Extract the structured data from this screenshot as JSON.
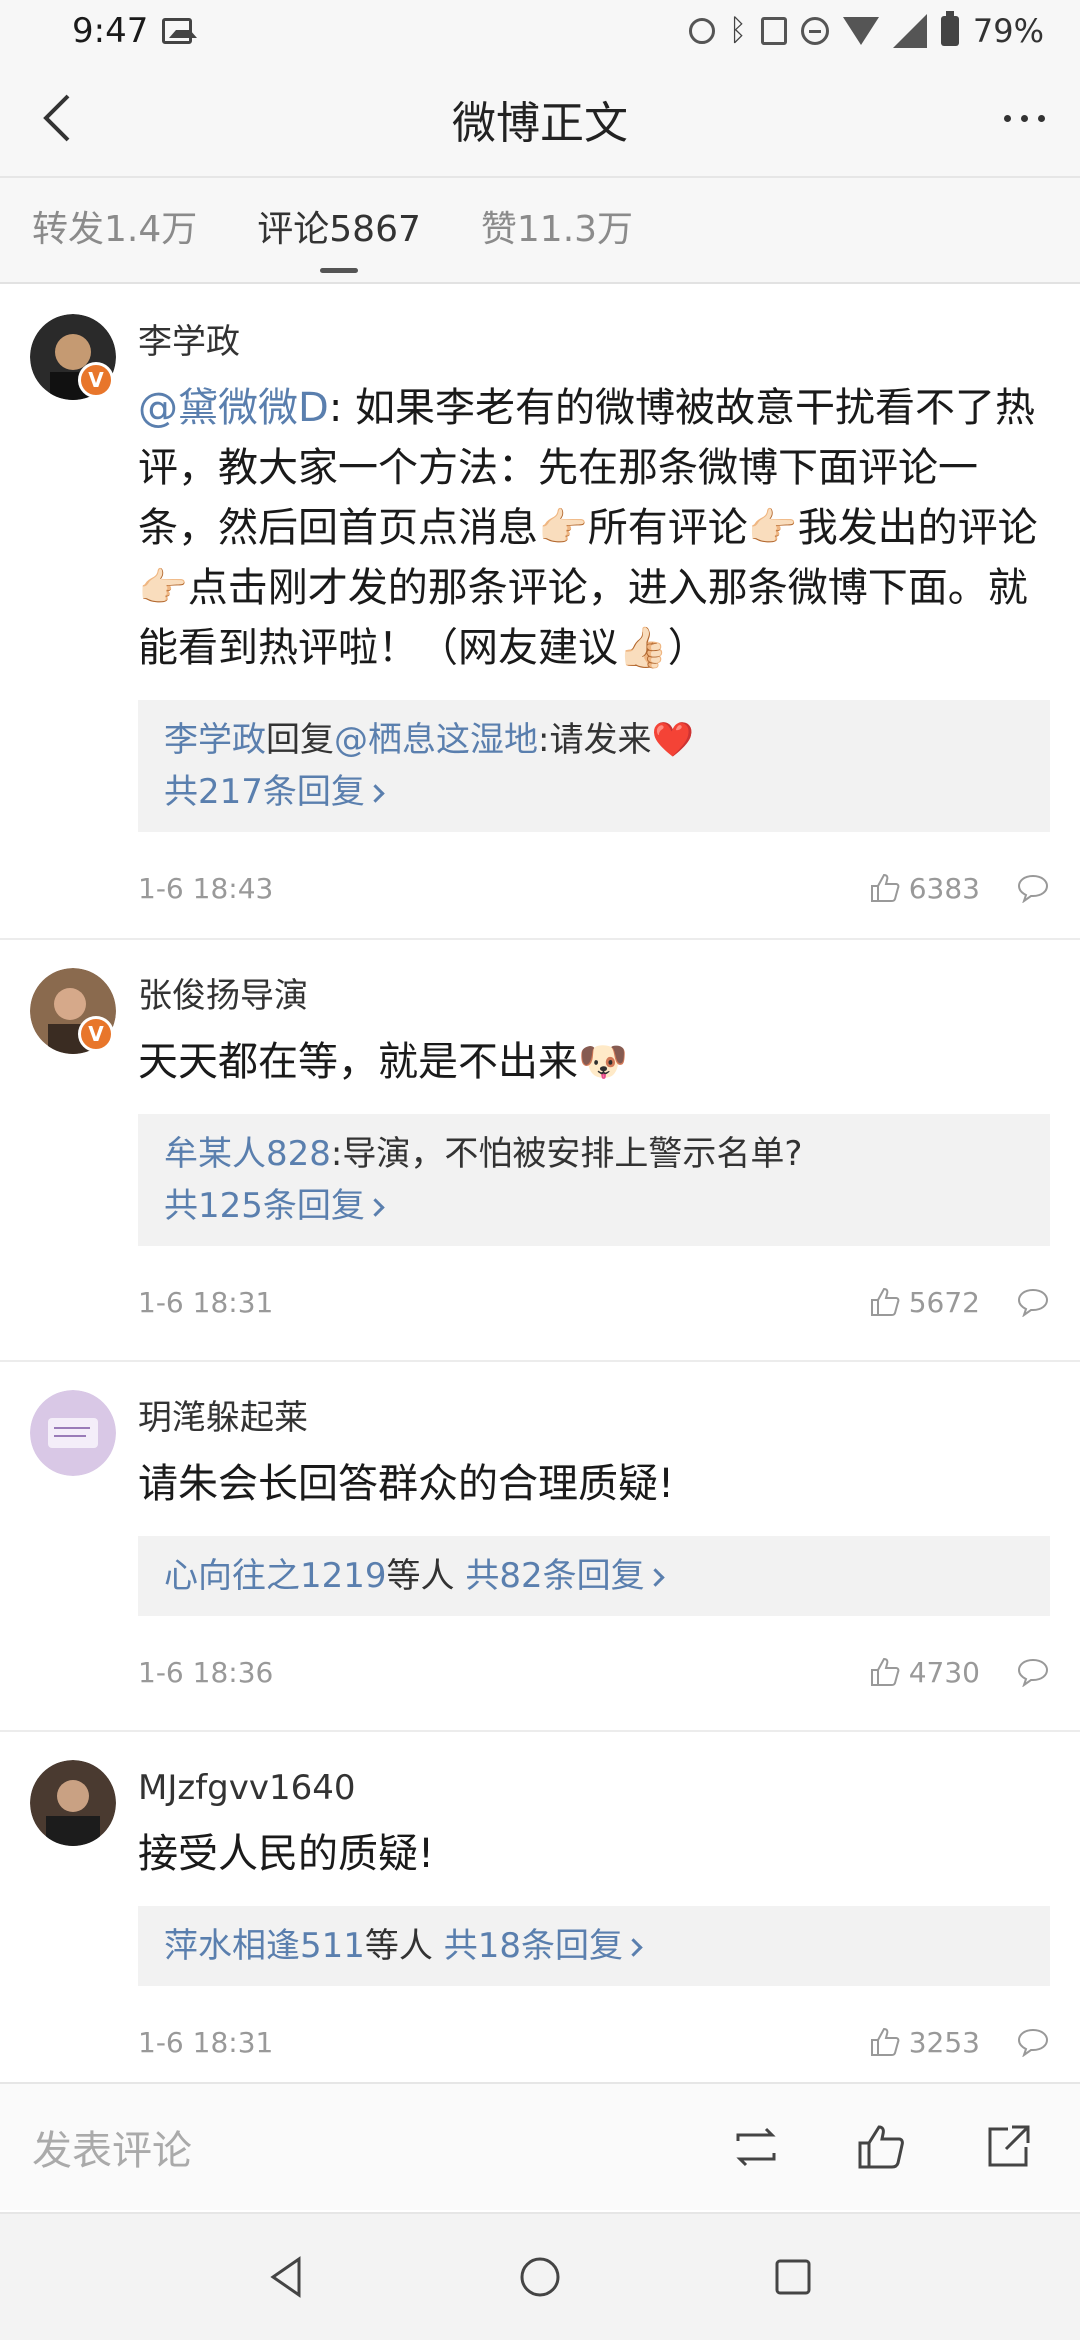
{
  "status_bar": {
    "time": "9:47",
    "battery": "79%",
    "icons": [
      "image-icon",
      "alarm-icon",
      "bluetooth-icon",
      "nfc-icon",
      "dnd-icon",
      "wifi-icon",
      "signal-icon",
      "battery-icon"
    ]
  },
  "header": {
    "title": "微博正文"
  },
  "tabs": [
    {
      "label": "转发1.4万",
      "active": false
    },
    {
      "label": "评论5867",
      "active": true
    },
    {
      "label": "赞11.3万",
      "active": false
    }
  ],
  "comments": [
    {
      "username": "李学政",
      "verified": true,
      "mention": "@黛微微D",
      "text": ": 如果李老有的微博被故意干扰看不了热评，教大家一个方法：先在那条微博下面评论一条，然后回首页点消息👉🏻所有评论👉🏻我发出的评论👉🏻点击刚才发的那条评论，进入那条微博下面。就能看到热评啦！（网友建议👍🏻）",
      "reply": {
        "author": "李学政",
        "action": "回复",
        "target": "@栖息这湿地",
        "text": ":请发来❤️",
        "more": "共217条回复"
      },
      "time": "1-6 18:43",
      "likes": "6383"
    },
    {
      "username": "张俊扬导演",
      "verified": true,
      "text": "天天都在等，就是不出来🐶",
      "reply": {
        "author": "牟某人828",
        "text": ":导演，不怕被安排上警示名单?",
        "more": "共125条回复"
      },
      "time": "1-6 18:31",
      "likes": "5672"
    },
    {
      "username": "玥滗躲起莱",
      "verified": false,
      "text": "请朱会长回答群众的合理质疑!",
      "reply": {
        "author": "心向往之1219",
        "suffix": "等人",
        "more": "共82条回复"
      },
      "time": "1-6 18:36",
      "likes": "4730"
    },
    {
      "username": "MJzfgvv1640",
      "verified": false,
      "text": "接受人民的质疑!",
      "reply": {
        "author": "萍水相逢511",
        "suffix": "等人",
        "more": "共18条回复"
      },
      "time": "1-6 18:31",
      "likes": "3253"
    }
  ],
  "bottom_bar": {
    "placeholder": "发表评论"
  },
  "colors": {
    "link": "#5a7fae",
    "badge": "#e8762b",
    "background": "#f7f7f7"
  }
}
